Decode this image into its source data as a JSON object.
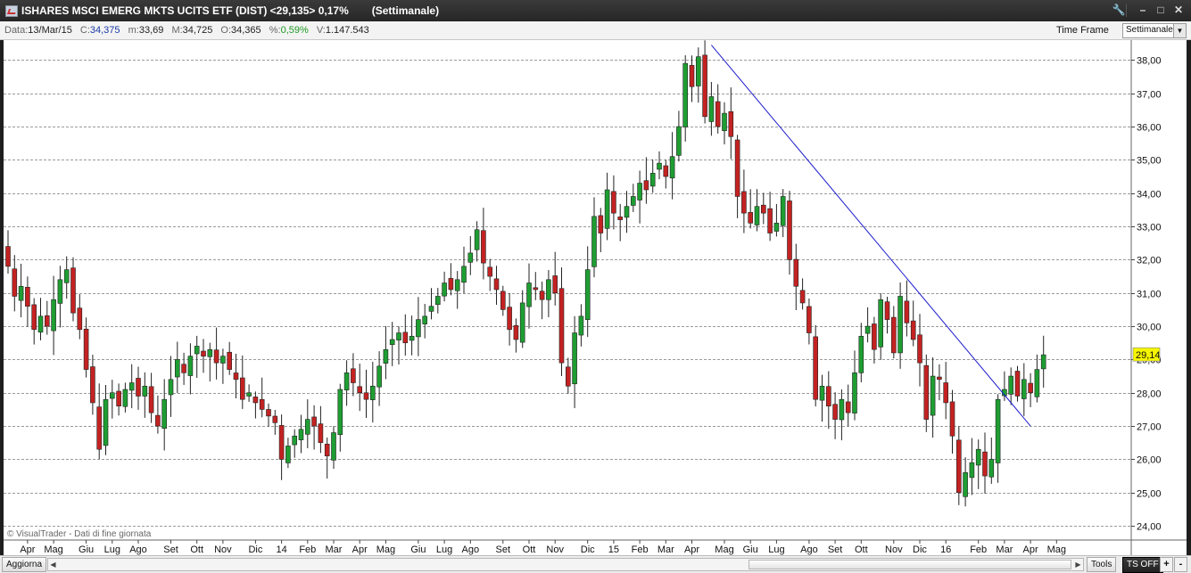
{
  "window": {
    "title": "ISHARES MSCI EMERG MKTS UCITS ETF (DIST) <29,135> 0,17%",
    "timeframe_title": "(Settimanale)",
    "buttons": [
      "wrench-icon",
      "minimize-icon",
      "maximize-icon",
      "close-icon"
    ]
  },
  "infobar": {
    "date_label": "Data:",
    "date": "13/Mar/15",
    "close_label": "C:",
    "close": "34,375",
    "low_label": "m:",
    "low": "33,69",
    "high_label": "M:",
    "high": "34,725",
    "open_label": "O:",
    "open": "34,365",
    "pct_label": "%:",
    "pct": "0,59%",
    "vol_label": "V:",
    "vol": "1.147.543",
    "timeframe_label": "Time Frame",
    "timeframe_value": "Settimanale"
  },
  "watermark": "© VisualTrader - Dati di fine giornata",
  "bottombar": {
    "aggiorna": "Aggiorna",
    "tools": "Tools",
    "tsoff": "TS OFF",
    "plus": "+",
    "minus": "-"
  },
  "colors": {
    "up": "#1e9e32",
    "down": "#c42222",
    "grid": "#9a9a9a",
    "trendline": "#1c1ccc",
    "price_tag": "#f5f500"
  },
  "chart_data": {
    "type": "candlestick",
    "ylim": [
      23.6,
      38.6
    ],
    "y_ticks": [
      "24,00",
      "25,00",
      "26,00",
      "27,00",
      "28,00",
      "29,00",
      "30,00",
      "31,00",
      "32,00",
      "33,00",
      "34,00",
      "35,00",
      "36,00",
      "37,00",
      "38,00"
    ],
    "y_tick_values": [
      24,
      25,
      26,
      27,
      28,
      29,
      30,
      31,
      32,
      33,
      34,
      35,
      36,
      37,
      38
    ],
    "current_price_label": "29,14",
    "current_price": 29.14,
    "x_labels": [
      {
        "label": "Apr",
        "week": 3
      },
      {
        "label": "Mag",
        "week": 7
      },
      {
        "label": "Giu",
        "week": 12
      },
      {
        "label": "Lug",
        "week": 16
      },
      {
        "label": "Ago",
        "week": 20
      },
      {
        "label": "Set",
        "week": 25
      },
      {
        "label": "Ott",
        "week": 29
      },
      {
        "label": "Nov",
        "week": 33
      },
      {
        "label": "Dic",
        "week": 38
      },
      {
        "label": "14",
        "week": 42
      },
      {
        "label": "Feb",
        "week": 46
      },
      {
        "label": "Mar",
        "week": 50
      },
      {
        "label": "Apr",
        "week": 54
      },
      {
        "label": "Mag",
        "week": 58
      },
      {
        "label": "Giu",
        "week": 63
      },
      {
        "label": "Lug",
        "week": 67
      },
      {
        "label": "Ago",
        "week": 71
      },
      {
        "label": "Set",
        "week": 76
      },
      {
        "label": "Ott",
        "week": 80
      },
      {
        "label": "Nov",
        "week": 84
      },
      {
        "label": "Dic",
        "week": 89
      },
      {
        "label": "15",
        "week": 93
      },
      {
        "label": "Feb",
        "week": 97
      },
      {
        "label": "Mar",
        "week": 101
      },
      {
        "label": "Apr",
        "week": 105
      },
      {
        "label": "Mag",
        "week": 110
      },
      {
        "label": "Giu",
        "week": 114
      },
      {
        "label": "Lug",
        "week": 118
      },
      {
        "label": "Ago",
        "week": 123
      },
      {
        "label": "Set",
        "week": 127
      },
      {
        "label": "Ott",
        "week": 131
      },
      {
        "label": "Nov",
        "week": 136
      },
      {
        "label": "Dic",
        "week": 140
      },
      {
        "label": "16",
        "week": 144
      },
      {
        "label": "Feb",
        "week": 149
      },
      {
        "label": "Mar",
        "week": 153
      },
      {
        "label": "Apr",
        "week": 157
      },
      {
        "label": "Mag",
        "week": 161
      }
    ],
    "trendline": {
      "from": {
        "week": 108,
        "price": 38.45
      },
      "to": {
        "week": 157,
        "price": 27.0
      }
    },
    "closes": [
      31.8,
      30.9,
      31.2,
      30.6,
      29.9,
      30.3,
      30.0,
      30.8,
      31.4,
      31.7,
      30.4,
      29.9,
      28.7,
      27.7,
      26.3,
      27.8,
      28.0,
      27.6,
      28.1,
      28.3,
      27.9,
      28.2,
      27.4,
      27.0,
      27.8,
      28.4,
      29.0,
      28.6,
      29.1,
      29.4,
      29.1,
      29.3,
      28.9,
      29.1,
      28.7,
      28.4,
      27.8,
      28.0,
      27.7,
      27.5,
      27.3,
      27.1,
      26.0,
      26.4,
      26.7,
      26.9,
      27.2,
      27.0,
      26.5,
      26.1,
      26.8,
      28.1,
      28.6,
      28.3,
      28.0,
      27.8,
      28.2,
      28.8,
      29.3,
      29.6,
      29.8,
      29.5,
      29.7,
      30.2,
      30.3,
      30.6,
      30.9,
      31.3,
      31.1,
      31.4,
      31.8,
      32.2,
      32.9,
      31.9,
      31.5,
      31.1,
      30.5,
      29.9,
      29.6,
      30.7,
      31.3,
      31.1,
      30.8,
      31.4,
      31.0,
      28.9,
      28.2,
      29.8,
      30.3,
      31.7,
      33.3,
      32.8,
      34.1,
      33.4,
      33.2,
      33.6,
      33.9,
      34.3,
      34.1,
      34.6,
      34.9,
      34.5,
      35.1,
      36.0,
      37.9,
      37.2,
      38.1,
      36.3,
      36.9,
      36.0,
      36.4,
      35.7,
      33.9,
      33.4,
      33.1,
      33.6,
      33.4,
      32.8,
      33.1,
      33.9,
      32.0,
      31.2,
      30.7,
      29.8,
      27.8,
      28.2,
      27.6,
      27.2,
      27.8,
      27.4,
      28.6,
      29.7,
      30.0,
      29.3,
      30.8,
      30.2,
      29.2,
      30.9,
      30.1,
      29.6,
      28.9,
      27.2,
      28.5,
      28.4,
      27.7,
      26.7,
      25.0,
      25.6,
      25.9,
      26.3,
      25.5,
      26.0,
      27.8,
      28.1,
      28.5,
      27.9,
      28.4,
      28.0,
      28.7,
      29.14
    ],
    "note": "weekly OHLC candles from Mar 2013 to Apr 2016 (values estimated from chart)"
  }
}
